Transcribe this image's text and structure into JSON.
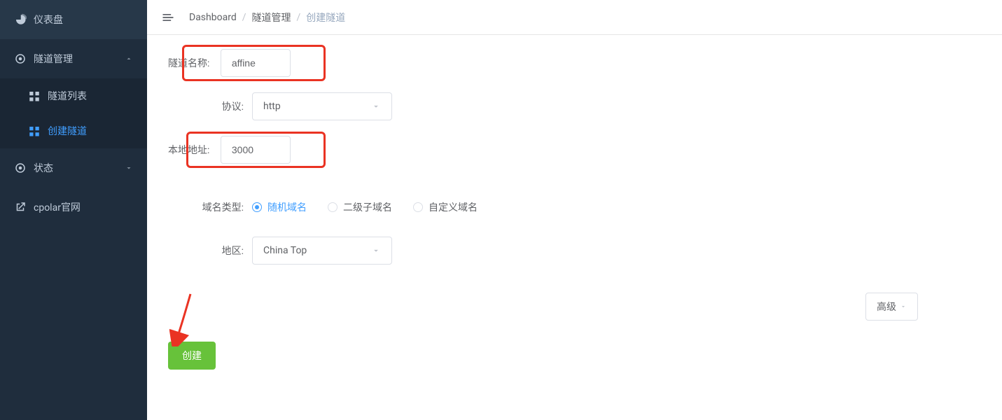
{
  "sidebar": {
    "items": [
      {
        "label": "仪表盘",
        "icon": "dashboard",
        "expandable": false
      },
      {
        "label": "隧道管理",
        "icon": "tunnel",
        "expandable": true,
        "expanded": true,
        "children": [
          {
            "label": "隧道列表",
            "active": false
          },
          {
            "label": "创建隧道",
            "active": true
          }
        ]
      },
      {
        "label": "状态",
        "icon": "status",
        "expandable": true,
        "expanded": false
      },
      {
        "label": "cpolar官网",
        "icon": "external",
        "expandable": false
      }
    ]
  },
  "breadcrumb": {
    "items": [
      "Dashboard",
      "隧道管理",
      "创建隧道"
    ]
  },
  "form": {
    "tunnel_name_label": "隧道名称:",
    "tunnel_name_value": "affine",
    "protocol_label": "协议:",
    "protocol_value": "http",
    "local_addr_label": "本地地址:",
    "local_addr_value": "3000",
    "domain_type_label": "域名类型:",
    "domain_options": [
      {
        "label": "随机域名",
        "checked": true
      },
      {
        "label": "二级子域名",
        "checked": false
      },
      {
        "label": "自定义域名",
        "checked": false
      }
    ],
    "region_label": "地区:",
    "region_value": "China Top",
    "advanced_label": "高级",
    "submit_label": "创建"
  }
}
